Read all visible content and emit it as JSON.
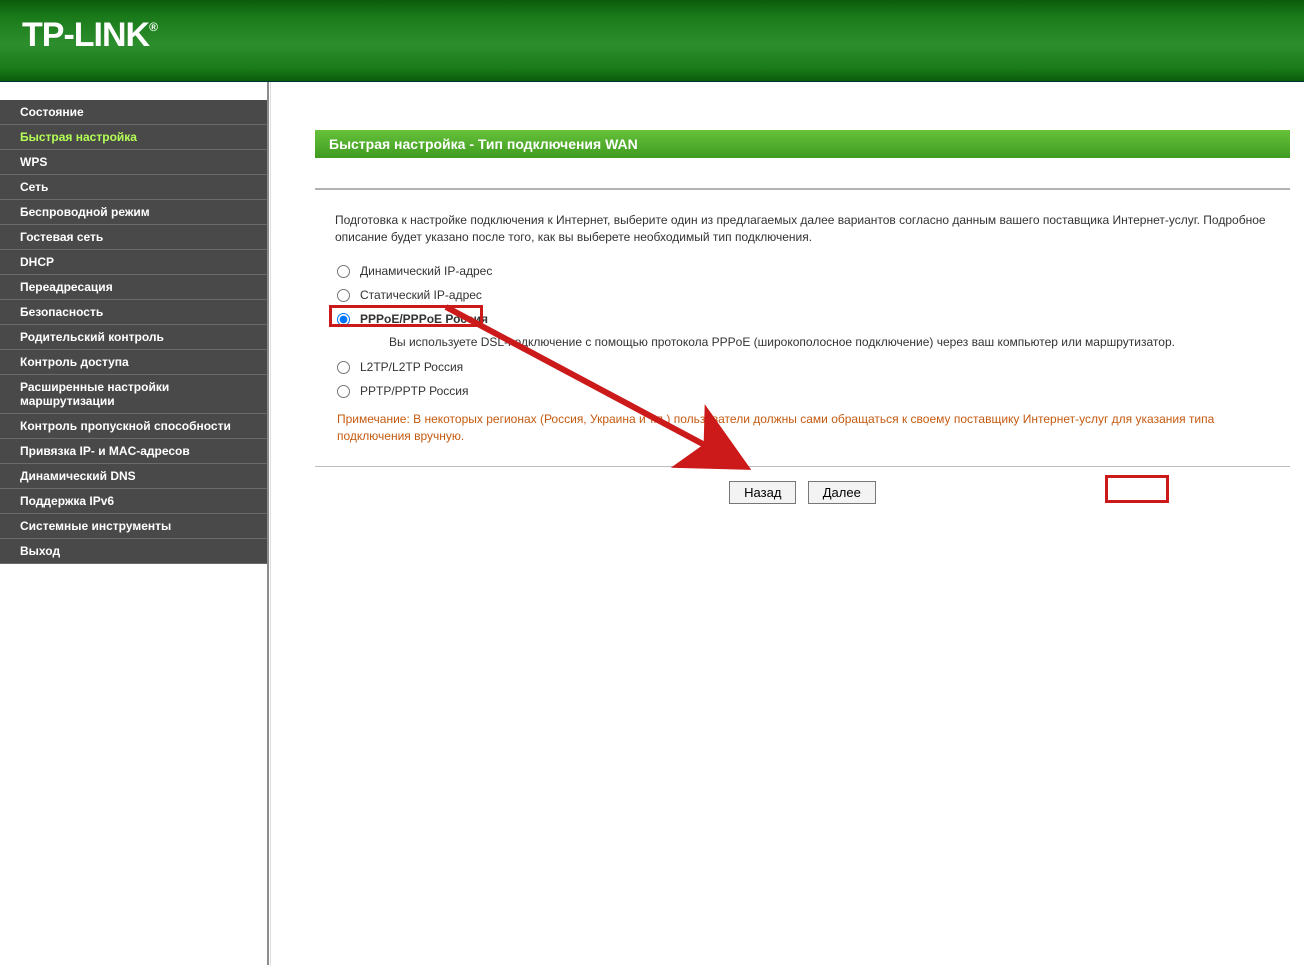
{
  "brand": "TP-LINK",
  "sidebar": {
    "items": [
      {
        "label": "Состояние"
      },
      {
        "label": "Быстрая настройка"
      },
      {
        "label": "WPS"
      },
      {
        "label": "Сеть"
      },
      {
        "label": "Беспроводной режим"
      },
      {
        "label": "Гостевая сеть"
      },
      {
        "label": "DHCP"
      },
      {
        "label": "Переадресация"
      },
      {
        "label": "Безопасность"
      },
      {
        "label": "Родительский контроль"
      },
      {
        "label": "Контроль доступа"
      },
      {
        "label": "Расширенные настройки маршрутизации"
      },
      {
        "label": "Контроль пропускной способности"
      },
      {
        "label": "Привязка IP- и MAC-адресов"
      },
      {
        "label": "Динамический DNS"
      },
      {
        "label": "Поддержка IPv6"
      },
      {
        "label": "Системные инструменты"
      },
      {
        "label": "Выход"
      }
    ],
    "activeIndex": 1
  },
  "page": {
    "title": "Быстрая настройка - Тип подключения WAN",
    "intro": "Подготовка к настройке подключения к Интернет, выберите один из предлагаемых далее вариантов согласно данным вашего поставщика Интернет-услуг. Подробное описание будет указано после того, как вы выберете необходимый тип подключения.",
    "options": [
      {
        "label": "Динамический IP-адрес"
      },
      {
        "label": "Статический IP-адрес"
      },
      {
        "label": "PPPoE/PPPoE Россия"
      },
      {
        "label": "L2TP/L2TP Россия"
      },
      {
        "label": "PPTP/PPTP Россия"
      }
    ],
    "selectedIndex": 2,
    "selectedDesc": "Вы используете DSL-подключение с помощью протокола PPPoE (широкополосное подключение) через ваш компьютер или маршрутизатор.",
    "note": "Примечание: В некоторых регионах (Россия, Украина и т.п.) пользователи должны сами обращаться к своему поставщику Интернет-услуг для указания типа подключения вручную.",
    "buttons": {
      "back": "Назад",
      "next": "Далее"
    }
  }
}
